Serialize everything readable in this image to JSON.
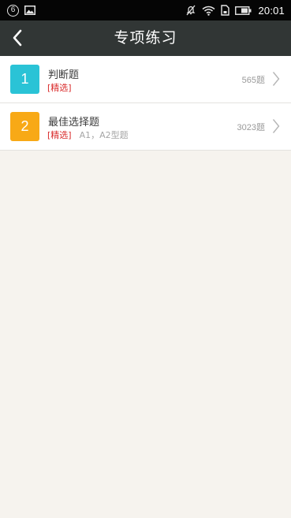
{
  "status_bar": {
    "notification_badge": "6",
    "time": "20:01",
    "icons": [
      "notification-badge-icon",
      "gallery-icon",
      "mute-icon",
      "wifi-icon",
      "sim-card-icon",
      "battery-icon"
    ]
  },
  "header": {
    "title": "专项练习",
    "back_icon": "chevron-left-icon"
  },
  "list": {
    "items": [
      {
        "number": "1",
        "title": "判断题",
        "tag": "[精选]",
        "description": "",
        "count": "565题",
        "badge_color": "#2ac3d6"
      },
      {
        "number": "2",
        "title": "最佳选择题",
        "tag": "[精选]",
        "description": "A1，A2型题",
        "count": "3023题",
        "badge_color": "#f8a916"
      }
    ]
  },
  "colors": {
    "status_bar": "#050505",
    "title_bar": "#313635",
    "page_background": "#f6f3ee",
    "tag": "#d92b2b"
  }
}
